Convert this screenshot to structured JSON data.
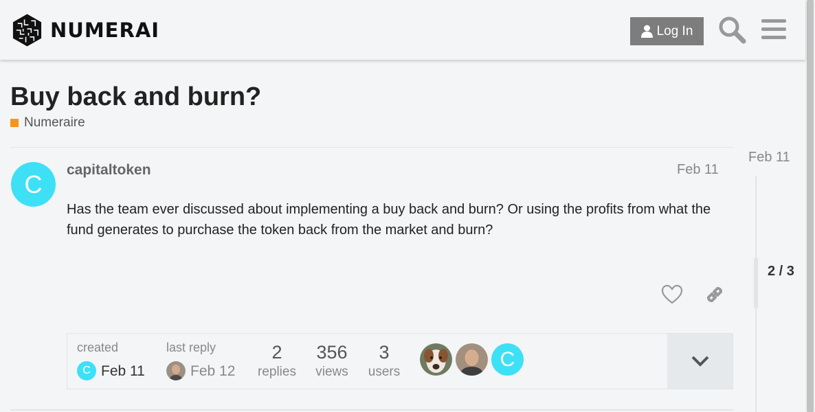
{
  "header": {
    "logo_text": "NUMERAI",
    "login_label": "Log In",
    "icons": {
      "user": "user-icon",
      "search": "search-icon",
      "menu": "hamburger-menu-icon"
    }
  },
  "topic": {
    "title": "Buy back and burn?",
    "category": "Numeraire",
    "category_color": "#f7941d"
  },
  "post": {
    "avatar_letter": "C",
    "avatar_color": "#3ee0f6",
    "username": "capitaltoken",
    "date": "Feb 11",
    "body": "Has the team ever discussed about implementing a buy back and burn? Or using the profits from what the fund generates to purchase the token back from the market and burn?",
    "actions": {
      "like_icon": "heart-icon",
      "share_icon": "link-icon"
    }
  },
  "topic_map": {
    "created_label": "created",
    "created_date": "Feb 11",
    "created_avatar_letter": "C",
    "last_reply_label": "last reply",
    "last_reply_date": "Feb 12",
    "replies_count": "2",
    "replies_label": "replies",
    "views_count": "356",
    "views_label": "views",
    "users_count": "3",
    "users_label": "users",
    "participant_c_letter": "C",
    "expand_icon": "chevron-down-icon"
  },
  "timeline": {
    "date": "Feb 11",
    "position": "2 / 3"
  }
}
